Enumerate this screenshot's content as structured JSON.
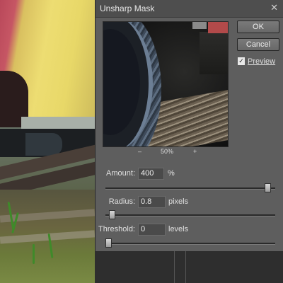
{
  "dialog": {
    "title": "Unsharp Mask",
    "close_icon": "close-icon",
    "ok_label": "OK",
    "cancel_label": "Cancel",
    "preview_label": "Preview",
    "preview_checked": true,
    "zoom": {
      "out_label": "–",
      "level": "50%",
      "in_label": "+"
    },
    "amount": {
      "label": "Amount:",
      "value": "400",
      "unit": "%",
      "slider_fraction": 0.97
    },
    "radius": {
      "label": "Radius:",
      "value": "0.8",
      "unit": "pixels",
      "slider_fraction": 0.02
    },
    "threshold": {
      "label": "Threshold:",
      "value": "0",
      "unit": "levels",
      "slider_fraction": 0.0
    }
  },
  "colors": {
    "dialog_bg": "#5e5e5e",
    "titlebar_bg": "#4e4e4e",
    "input_bg": "#4a4a4a"
  }
}
